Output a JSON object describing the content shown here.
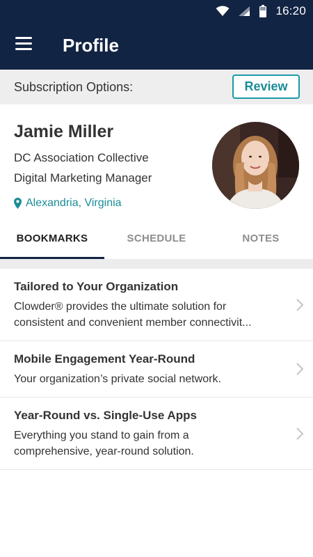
{
  "status_bar": {
    "time": "16:20",
    "icons": [
      "wifi-icon",
      "cellular-signal-icon",
      "battery-icon"
    ]
  },
  "app_bar": {
    "title": "Profile",
    "menu_icon": "hamburger-menu-icon"
  },
  "subscription": {
    "label": "Subscription Options:",
    "button_label": "Review"
  },
  "profile": {
    "name": "Jamie Miller",
    "organization": "DC Association Collective",
    "role": "Digital Marketing Manager",
    "location": "Alexandria, Virginia",
    "location_icon": "map-pin-icon"
  },
  "tabs": [
    {
      "label": "BOOKMARKS",
      "active": true
    },
    {
      "label": "SCHEDULE",
      "active": false
    },
    {
      "label": "NOTES",
      "active": false
    }
  ],
  "bookmarks": [
    {
      "title": "Tailored to Your Organization",
      "desc_line1": "Clowder® provides the ultimate solution for",
      "desc_line2": "consistent and convenient member connectivit..."
    },
    {
      "title": "Mobile Engagement Year-Round",
      "desc_line1": "Your organization’s private social network.",
      "desc_line2": ""
    },
    {
      "title": "Year-Round vs. Single-Use Apps",
      "desc_line1": "Everything you stand to gain from a",
      "desc_line2": "comprehensive, year-round solution."
    }
  ],
  "colors": {
    "header_navy": "#122443",
    "accent_teal": "#1a8c97",
    "band_gray": "#eeeeee"
  }
}
